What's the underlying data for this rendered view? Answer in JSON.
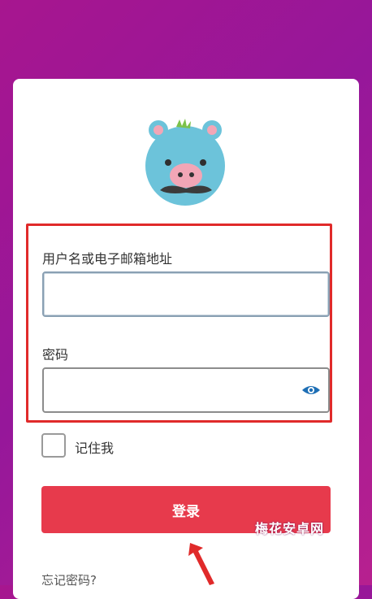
{
  "login": {
    "username_label": "用户名或电子邮箱地址",
    "username_value": "",
    "password_label": "密码",
    "password_value": "",
    "remember_label": "记住我",
    "remember_checked": false,
    "submit_label": "登录",
    "forgot_label": "忘记密码?"
  },
  "watermark": "梅花安卓网",
  "colors": {
    "background": "#a7168f",
    "button": "#e73a4c",
    "annotation": "#e02a2a"
  },
  "icons": {
    "logo": "mascot-logo-icon",
    "password_toggle": "eye-icon",
    "pointer": "arrow-icon"
  }
}
